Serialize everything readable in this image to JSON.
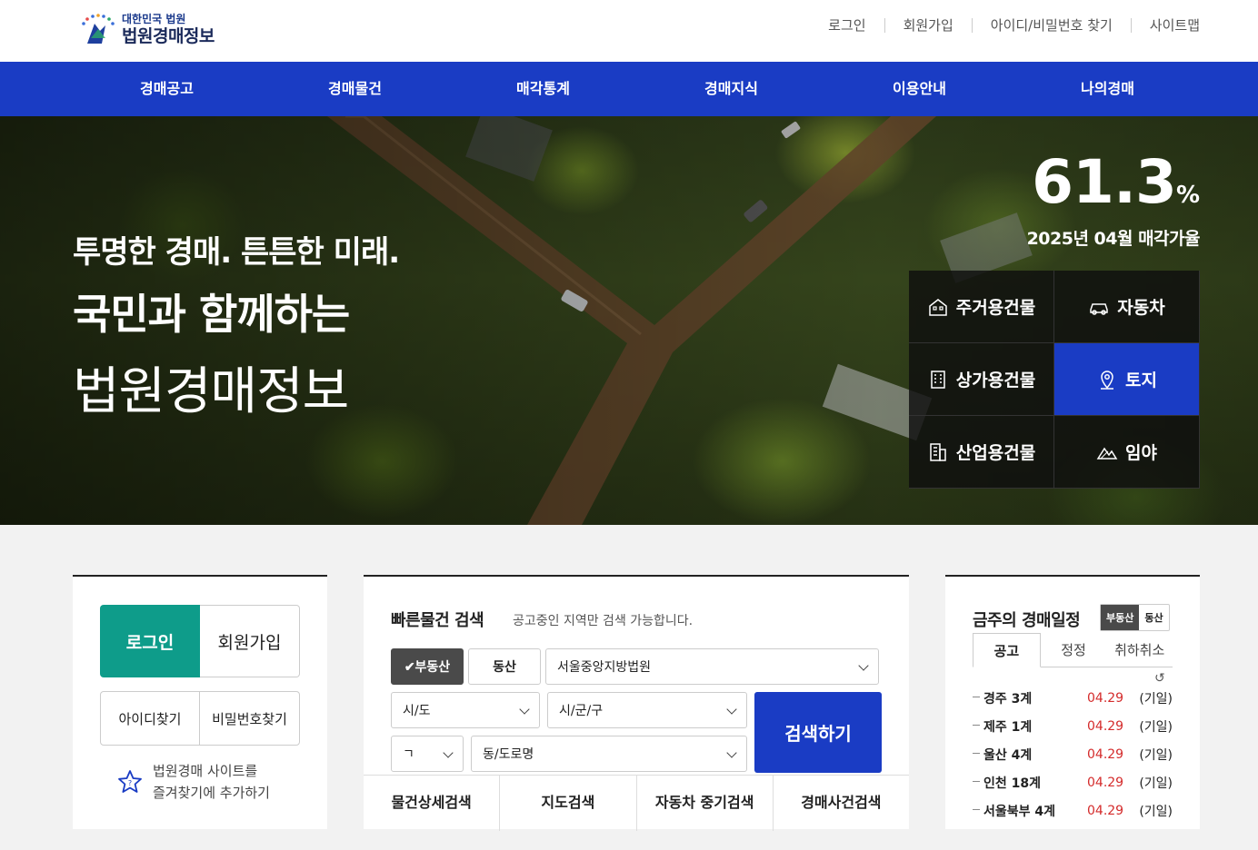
{
  "header": {
    "logo_sub": "대한민국 법원",
    "logo_main": "법원경매정보",
    "util": [
      "로그인",
      "회원가입",
      "아이디/비밀번호 찾기",
      "사이트맵"
    ]
  },
  "nav": [
    "경매공고",
    "경매물건",
    "매각통계",
    "경매지식",
    "이용안내",
    "나의경매"
  ],
  "hero": {
    "line1": "투명한 경매. 튼튼한 미래.",
    "line2": "국민과 함께하는",
    "line3": "법원경매정보",
    "rate_value": "61.3",
    "rate_unit": "%",
    "rate_label": "2025년 04월 매각가율",
    "categories": [
      {
        "label": "주거용건물",
        "icon": "house-icon"
      },
      {
        "label": "자동차",
        "icon": "car-icon"
      },
      {
        "label": "상가용건물",
        "icon": "building-icon"
      },
      {
        "label": "토지",
        "icon": "map-pin-icon"
      },
      {
        "label": "산업용건물",
        "icon": "factory-icon"
      },
      {
        "label": "임야",
        "icon": "mountain-icon"
      }
    ],
    "active_category": "토지"
  },
  "login_panel": {
    "login": "로그인",
    "join": "회원가입",
    "find_id": "아이디찾기",
    "find_pw": "비밀번호찾기",
    "fav_line1": "법원경매 사이트를",
    "fav_line2": "즐겨찾기에 추가하기"
  },
  "search_panel": {
    "title": "빠른물건 검색",
    "subtitle": "공고중인 지역만 검색 가능합니다.",
    "toggle_realestate": "✔부동산",
    "toggle_movable": "동산",
    "court": "서울중앙지방법원",
    "sido": "시/도",
    "sigungu": "시/군/구",
    "initial": "ㄱ",
    "dong": "동/도로명",
    "search_button": "검색하기",
    "tabs": [
      "물건상세검색",
      "지도검색",
      "자동차 중기검색",
      "경매사건검색"
    ]
  },
  "schedule_panel": {
    "title": "금주의 경매일정",
    "toggle_realestate": "부동산",
    "toggle_movable": "동산",
    "tabs": [
      "공고",
      "정정",
      "취하취소"
    ],
    "refresh": "↺",
    "items": [
      {
        "name": "경주 3계",
        "date": "04.29",
        "status": "(기일)"
      },
      {
        "name": "제주 1계",
        "date": "04.29",
        "status": "(기일)"
      },
      {
        "name": "울산 4계",
        "date": "04.29",
        "status": "(기일)"
      },
      {
        "name": "인천 18계",
        "date": "04.29",
        "status": "(기일)"
      },
      {
        "name": "서울북부 4계",
        "date": "04.29",
        "status": "(기일)"
      }
    ]
  },
  "colors": {
    "brand_blue": "#1a3cc4",
    "teal": "#0e9c8a",
    "date_red": "#d42b2b"
  }
}
